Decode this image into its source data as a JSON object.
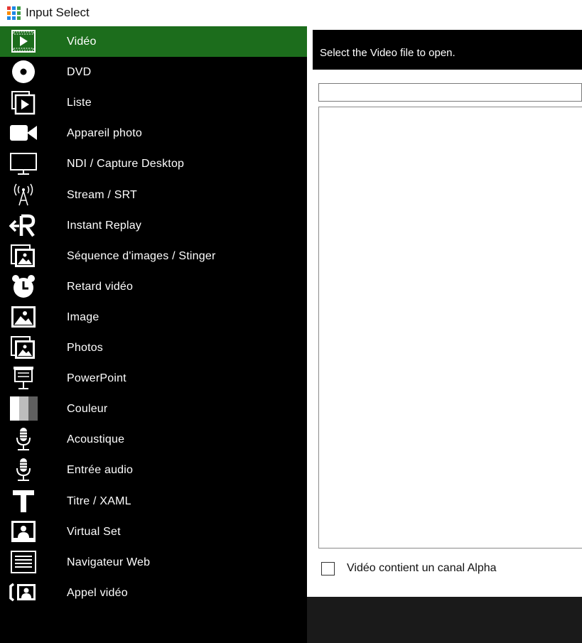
{
  "window": {
    "title": "Input Select",
    "icon": "grid-app-icon"
  },
  "sidebar": {
    "active_index": 0,
    "items": [
      {
        "label": "Vidéo",
        "icon": "video-icon"
      },
      {
        "label": "DVD",
        "icon": "dvd-icon"
      },
      {
        "label": "Liste",
        "icon": "playlist-icon"
      },
      {
        "label": "Appareil photo",
        "icon": "camera-icon"
      },
      {
        "label": "NDI / Capture Desktop",
        "icon": "monitor-icon"
      },
      {
        "label": "Stream / SRT",
        "icon": "antenna-icon"
      },
      {
        "label": "Instant Replay",
        "icon": "replay-icon"
      },
      {
        "label": "Séquence d'images / Stinger",
        "icon": "image-sequence-icon"
      },
      {
        "label": "Retard vidéo",
        "icon": "clock-icon"
      },
      {
        "label": "Image",
        "icon": "image-icon"
      },
      {
        "label": "Photos",
        "icon": "photos-icon"
      },
      {
        "label": "PowerPoint",
        "icon": "presentation-icon"
      },
      {
        "label": "Couleur",
        "icon": "color-icon"
      },
      {
        "label": "Acoustique",
        "icon": "microphone-icon"
      },
      {
        "label": "Entrée audio",
        "icon": "microphone-icon"
      },
      {
        "label": "Titre / XAML",
        "icon": "title-icon"
      },
      {
        "label": "Virtual Set",
        "icon": "virtual-set-icon"
      },
      {
        "label": "Navigateur Web",
        "icon": "browser-icon"
      },
      {
        "label": "Appel vidéo",
        "icon": "video-call-icon"
      }
    ]
  },
  "main": {
    "prompt": "Select the Video file to open.",
    "path_value": "",
    "alpha_checkbox": {
      "label": "Vidéo contient un canal Alpha",
      "checked": false
    }
  },
  "colors": {
    "sidebar_bg": "#000000",
    "active_bg": "#1c6d1c",
    "text_light": "#ffffff",
    "footer_bg": "#1a1a1a"
  }
}
